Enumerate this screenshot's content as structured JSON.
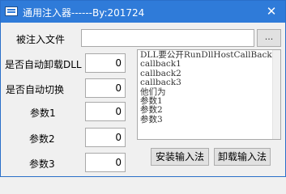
{
  "window": {
    "title": "通用注入器------By:201724",
    "close_glyph": "✕"
  },
  "form": {
    "target_file_label": "被注入文件",
    "target_file_value": "",
    "browse_label": "...",
    "auto_unload_label": "是否自动卸载DLL",
    "auto_unload_value": "0",
    "auto_switch_label": "是否自动切换",
    "auto_switch_value": "0",
    "param1_label": "参数1",
    "param1_value": "0",
    "param2_label": "参数2",
    "param2_value": "0",
    "param3_label": "参数3",
    "param3_value": "0"
  },
  "memo": {
    "lines": [
      "DLL要公开RunDllHostCallBack",
      "callback1",
      "callback2",
      "callback3",
      "他们为",
      "参数1",
      "参数2",
      "参数3"
    ]
  },
  "buttons": {
    "install_label": "安装输入法",
    "uninstall_label": "卸载输入法"
  },
  "colors": {
    "titlebar": "#2f7bd9",
    "window_bg": "#f0f0f0"
  }
}
